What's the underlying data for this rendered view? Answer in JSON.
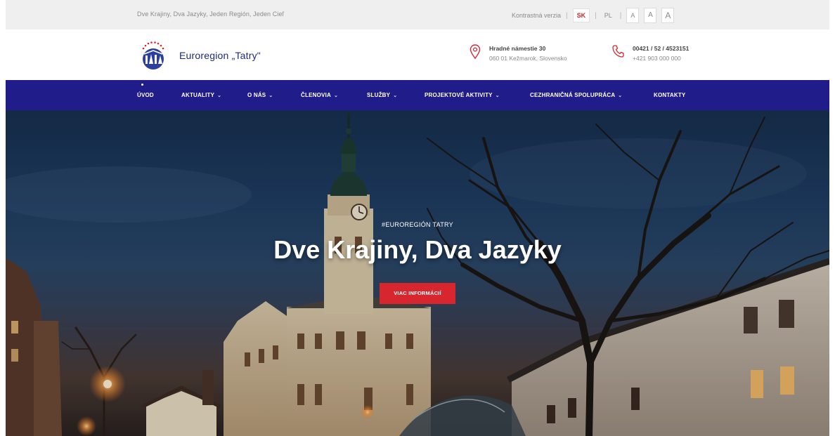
{
  "topbar": {
    "tagline": "Dve Krajiny, Dva Jazyky, Jeden Región, Jeden Cieľ",
    "contrast_label": "Kontrastná verzia",
    "lang_sk": "SK",
    "lang_pl": "PL",
    "font_small": "A",
    "font_medium": "A",
    "font_large": "A"
  },
  "header": {
    "brand": "Euroregion „Tatry\"",
    "address_line1": "Hradné námestie 30",
    "address_line2": "060 01 Kežmarok, Slovensko",
    "phone_line1": "00421 / 52 / 4523151",
    "phone_line2": "+421 903 000 000"
  },
  "nav": {
    "items": [
      {
        "label": "ÚVOD",
        "dropdown": false
      },
      {
        "label": "AKTUALITY",
        "dropdown": true
      },
      {
        "label": "O NÁS",
        "dropdown": true
      },
      {
        "label": "ČLENOVIA",
        "dropdown": true
      },
      {
        "label": "SLUŽBY",
        "dropdown": true
      },
      {
        "label": "PROJEKTOVÉ AKTIVITY",
        "dropdown": true
      },
      {
        "label": "CEZHRANIČNÁ SPOLUPRÁCA",
        "dropdown": true
      },
      {
        "label": "KONTAKTY",
        "dropdown": false
      }
    ],
    "caret": "⌄"
  },
  "hero": {
    "kicker": "#EUROREGIÓN TATRY",
    "title": "Dve Krajiny, Dva Jazyky",
    "button_label": "VIAC INFORMÁCIÍ"
  },
  "colors": {
    "nav_bg": "#201d8a",
    "accent_red": "#d8262f",
    "brand_blue": "#1e2a78"
  },
  "icons": {
    "location": "map-pin-icon",
    "phone": "phone-icon",
    "logo": "euroregion-tatry-logo"
  }
}
